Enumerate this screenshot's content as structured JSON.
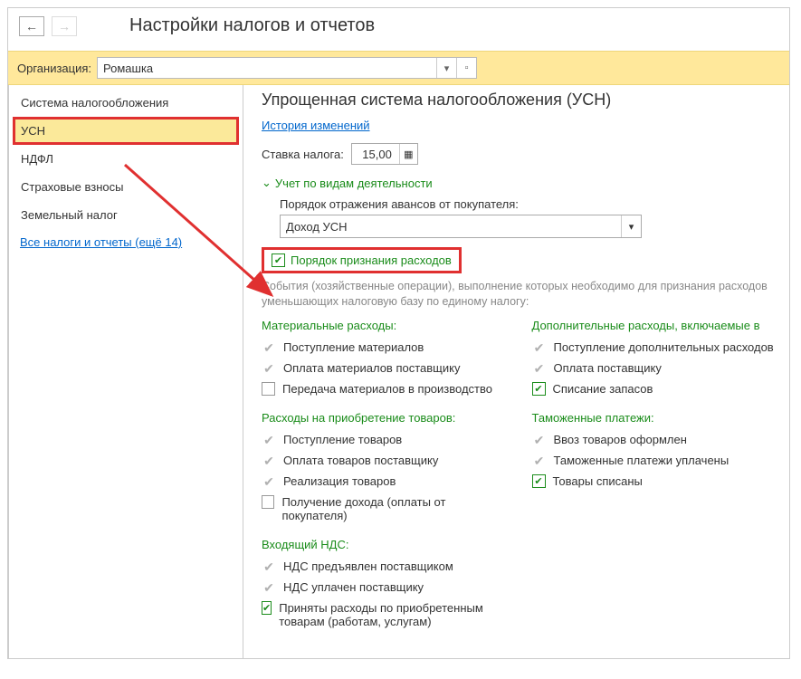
{
  "header": {
    "title": "Настройки налогов и отчетов"
  },
  "org": {
    "label": "Организация:",
    "value": "Ромашка"
  },
  "sidebar": {
    "items": [
      {
        "label": "Система налогообложения"
      },
      {
        "label": "УСН"
      },
      {
        "label": "НДФЛ"
      },
      {
        "label": "Страховые взносы"
      },
      {
        "label": "Земельный налог"
      }
    ],
    "link": "Все налоги и отчеты (ещё 14)"
  },
  "main": {
    "title": "Упрощенная система налогообложения (УСН)",
    "history_link": "История изменений",
    "rate_label": "Ставка налога:",
    "rate_value": "15,00",
    "section_activity": "Учет по видам деятельности",
    "advance_label": "Порядок отражения авансов от покупателя:",
    "advance_value": "Доход УСН",
    "recognition_label": "Порядок признания расходов",
    "desc": "События (хозяйственные операции), выполнение которых необходимо для признания расходов уменьшающих налоговую базу по единому налогу:",
    "groups": {
      "material": {
        "title": "Материальные расходы:",
        "items": [
          {
            "label": "Поступление материалов",
            "type": "fixed"
          },
          {
            "label": "Оплата материалов поставщику",
            "type": "fixed"
          },
          {
            "label": "Передача материалов в производство",
            "type": "checkbox",
            "checked": false
          }
        ]
      },
      "goods": {
        "title": "Расходы на приобретение товаров:",
        "items": [
          {
            "label": "Поступление товаров",
            "type": "fixed"
          },
          {
            "label": "Оплата товаров поставщику",
            "type": "fixed"
          },
          {
            "label": "Реализация товаров",
            "type": "fixed"
          },
          {
            "label": "Получение дохода (оплаты от покупателя)",
            "type": "checkbox",
            "checked": false
          }
        ]
      },
      "vat": {
        "title": "Входящий НДС:",
        "items": [
          {
            "label": "НДС предъявлен поставщиком",
            "type": "fixed"
          },
          {
            "label": "НДС уплачен поставщику",
            "type": "fixed"
          },
          {
            "label": "Приняты расходы по приобретенным товарам (работам, услугам)",
            "type": "checkbox",
            "checked": true
          }
        ]
      },
      "additional": {
        "title": "Дополнительные расходы, включаемые в",
        "items": [
          {
            "label": "Поступление дополнительных расходов",
            "type": "fixed"
          },
          {
            "label": "Оплата поставщику",
            "type": "fixed"
          },
          {
            "label": "Списание запасов",
            "type": "checkbox",
            "checked": true
          }
        ]
      },
      "customs": {
        "title": "Таможенные платежи:",
        "items": [
          {
            "label": "Ввоз товаров оформлен",
            "type": "fixed"
          },
          {
            "label": "Таможенные платежи уплачены",
            "type": "fixed"
          },
          {
            "label": "Товары списаны",
            "type": "checkbox",
            "checked": true
          }
        ]
      }
    }
  }
}
